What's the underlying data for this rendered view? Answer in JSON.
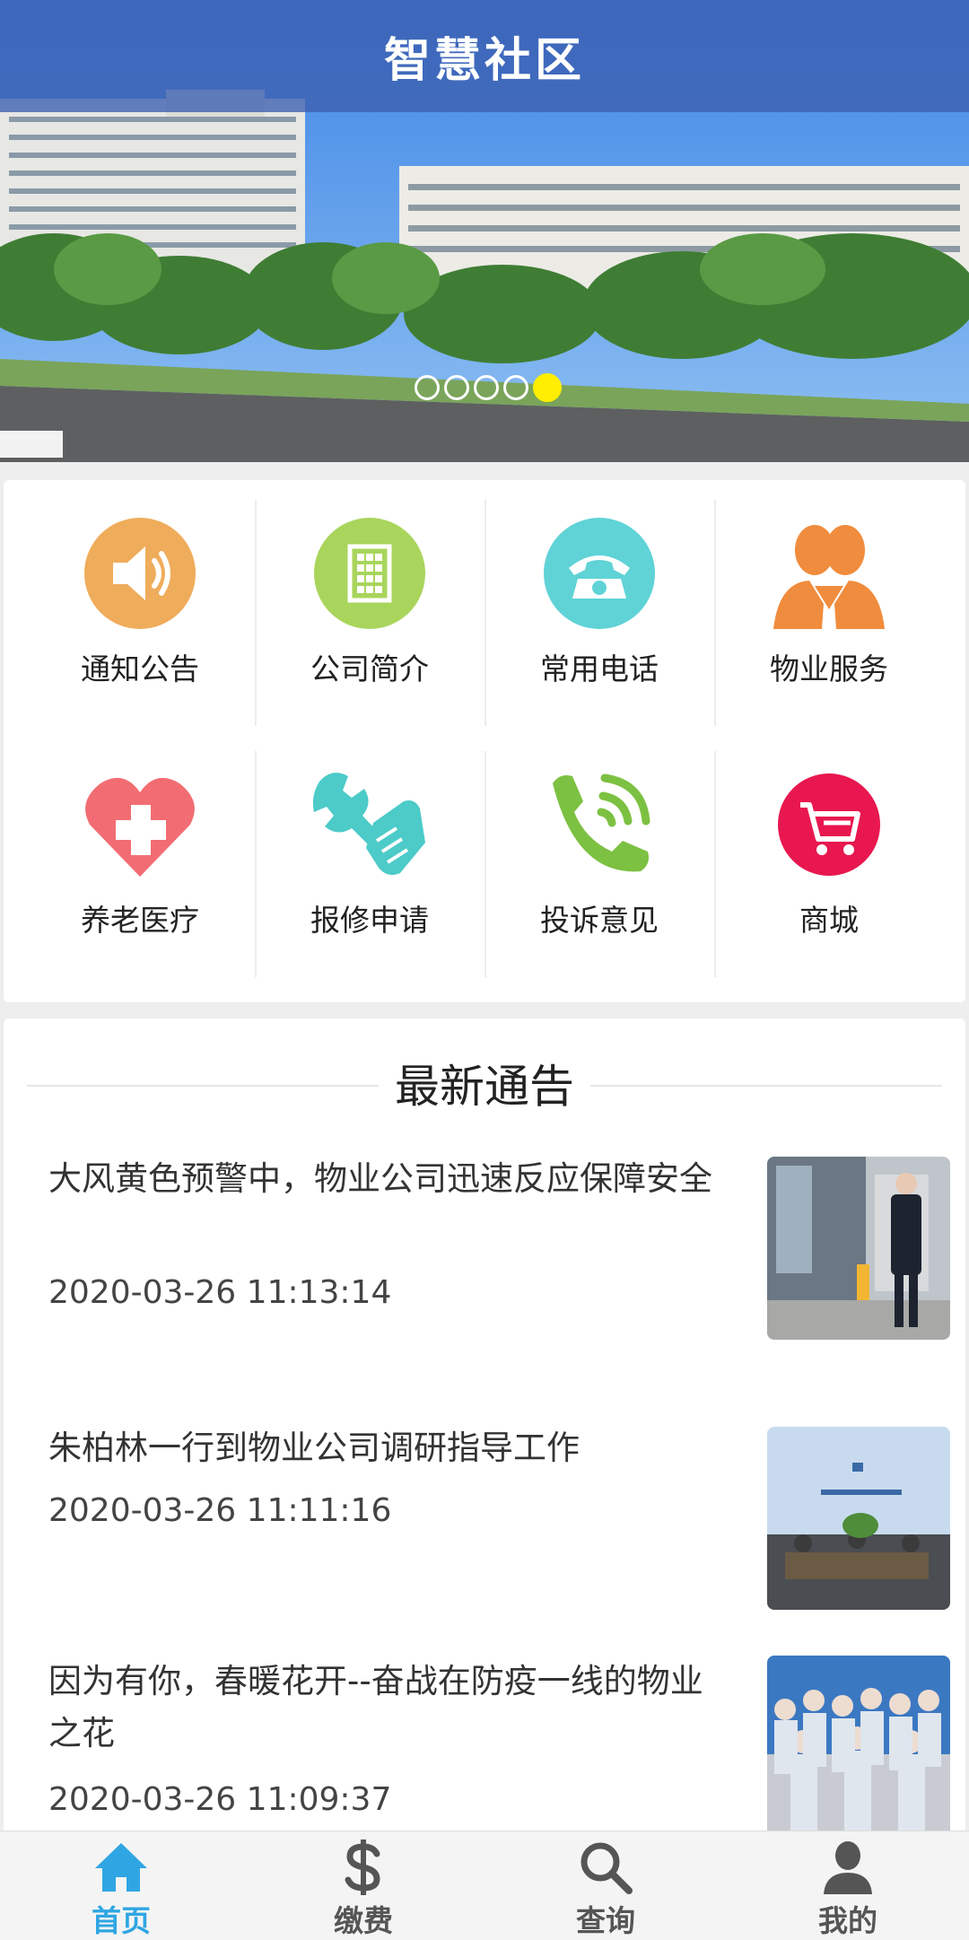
{
  "header": {
    "title": "智慧社区",
    "carousel_total": 5,
    "carousel_active": 5
  },
  "menu": {
    "items": [
      {
        "label": "通知公告",
        "icon": "speaker-icon",
        "color": "#efac5b"
      },
      {
        "label": "公司简介",
        "icon": "building-icon",
        "color": "#a9d55c"
      },
      {
        "label": "常用电话",
        "icon": "telephone-icon",
        "color": "#5fd3d6"
      },
      {
        "label": "物业服务",
        "icon": "people-icon",
        "color": "#f08c3d"
      },
      {
        "label": "养老医疗",
        "icon": "heart-cross-icon",
        "color": "#f26d73"
      },
      {
        "label": "报修申请",
        "icon": "wrench-hand-icon",
        "color": "#4ccbc8"
      },
      {
        "label": "投诉意见",
        "icon": "phone-call-icon",
        "color": "#7cc142"
      },
      {
        "label": "商城",
        "icon": "cart-icon",
        "color": "#e8174f"
      }
    ]
  },
  "news": {
    "heading": "最新通告",
    "items": [
      {
        "title": "大风黄色预警中，物业公司迅速反应保障安全",
        "date": "2020-03-26 11:13:14",
        "thumb": "security-guard-photo"
      },
      {
        "title": "朱柏林一行到物业公司调研指导工作",
        "date": "2020-03-26 11:11:16",
        "thumb": "meeting-photo"
      },
      {
        "title": "因为有你，春暖花开--奋战在防疫一线的物业之花",
        "date": "2020-03-26 11:09:37",
        "thumb": "staff-group-photo"
      }
    ]
  },
  "nav": {
    "items": [
      {
        "label": "首页",
        "icon": "home-icon",
        "active": true
      },
      {
        "label": "缴费",
        "icon": "dollar-icon",
        "active": false
      },
      {
        "label": "查询",
        "icon": "search-icon",
        "active": false
      },
      {
        "label": "我的",
        "icon": "user-icon",
        "active": false
      }
    ],
    "active_color": "#2fa6e3",
    "inactive_color": "#555555"
  }
}
